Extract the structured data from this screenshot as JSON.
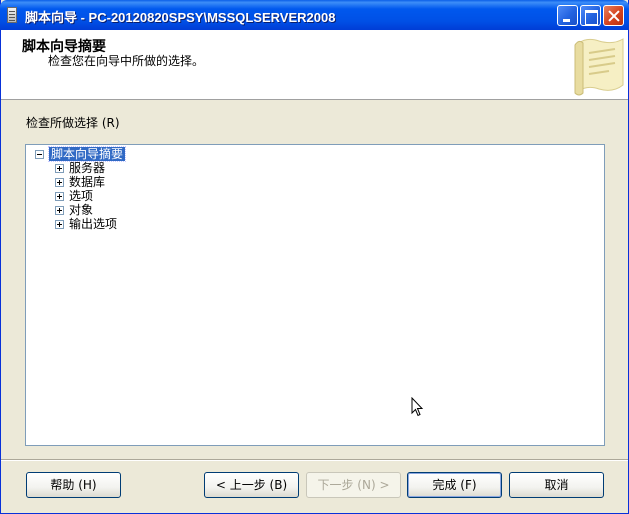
{
  "window": {
    "title": "脚本向导 - PC-20120820SPSY\\MSSQLSERVER2008"
  },
  "header": {
    "title": "脚本向导摘要",
    "subtitle": "检查您在向导中所做的选择。",
    "icon": "scroll-icon"
  },
  "review": {
    "label": "检查所做选择 (R)",
    "tree": {
      "root": "脚本向导摘要",
      "items": [
        {
          "label": "服务器"
        },
        {
          "label": "数据库"
        },
        {
          "label": "选项"
        },
        {
          "label": "对象"
        },
        {
          "label": "输出选项"
        }
      ]
    }
  },
  "buttons": {
    "help": "帮助 (H)",
    "back": "< 上一步 (B)",
    "next": "下一步 (N) >",
    "finish": "完成 (F)",
    "cancel": "取消"
  },
  "colors": {
    "titlebar": "#0058ee",
    "selection": "#316ac5",
    "dialog_bg": "#ece9d8"
  }
}
